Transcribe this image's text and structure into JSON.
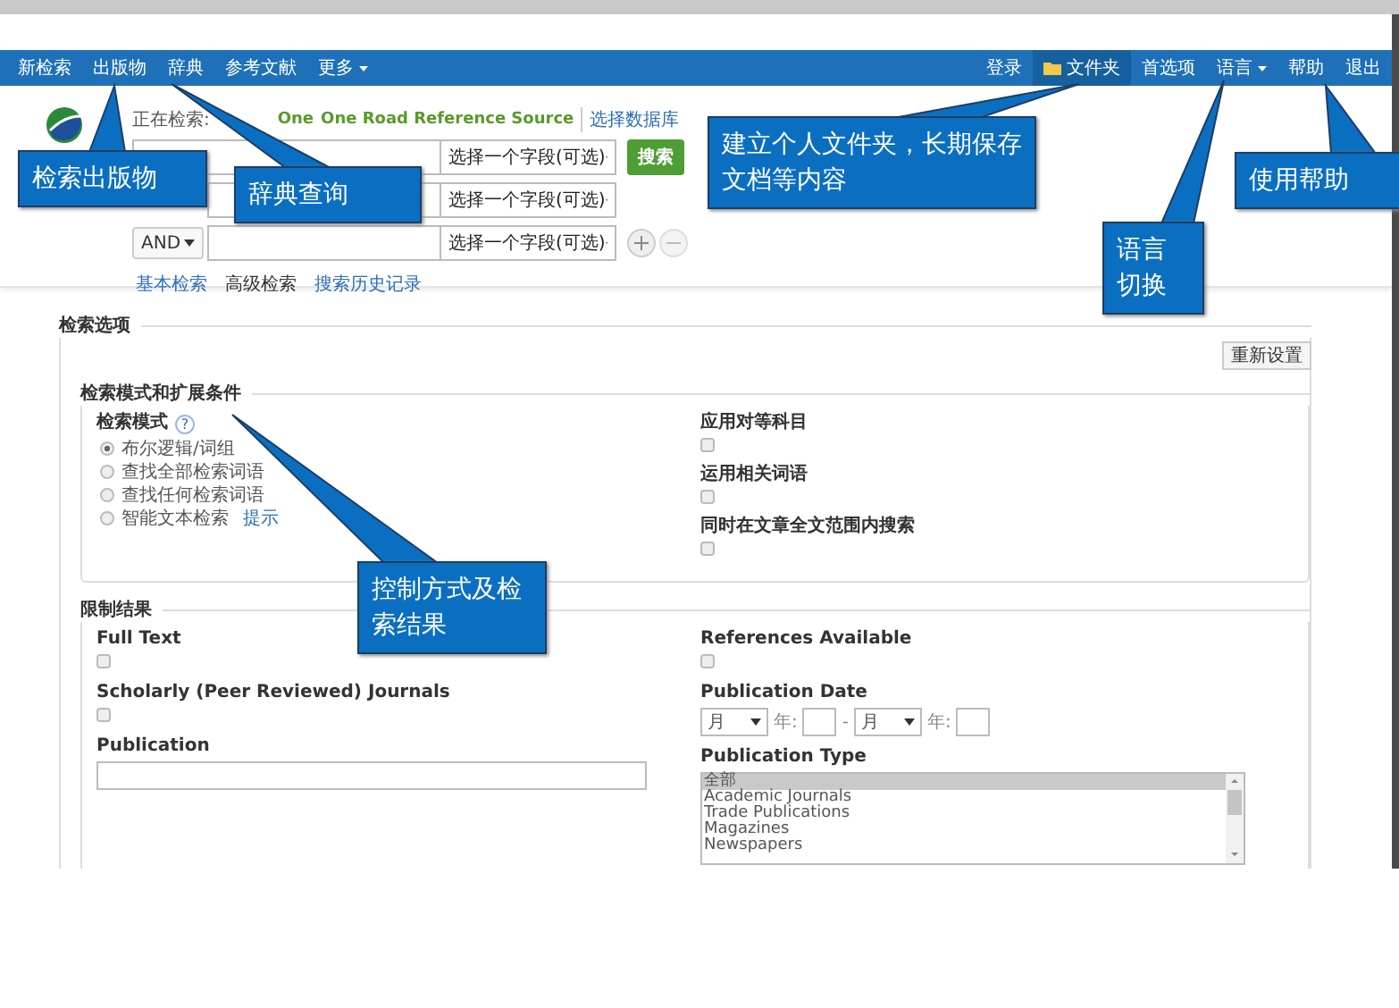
{
  "nav": {
    "left": [
      {
        "label": "新检索",
        "kind": "link"
      },
      {
        "label": "出版物",
        "kind": "link"
      },
      {
        "label": "辞典",
        "kind": "link"
      },
      {
        "label": "参考文献",
        "kind": "link"
      },
      {
        "label": "更多",
        "kind": "menu"
      }
    ],
    "right": [
      {
        "label": "登录",
        "kind": "link"
      },
      {
        "label": "文件夹",
        "kind": "folder"
      },
      {
        "label": "首选项",
        "kind": "link"
      },
      {
        "label": "语言",
        "kind": "menu"
      },
      {
        "label": "帮助",
        "kind": "link"
      },
      {
        "label": "退出",
        "kind": "link"
      }
    ]
  },
  "search": {
    "searching_label": "正在检索:",
    "database_parts": [
      "One",
      "One Road Reference Source"
    ],
    "choose_db_link": "选择数据库",
    "rows": [
      {
        "field": "选择一个字段(可选)"
      },
      {
        "field": "选择一个字段(可选)"
      },
      {
        "operator": "AND",
        "field": "选择一个字段(可选)"
      }
    ],
    "search_button": "搜索",
    "links": [
      {
        "label": "基本检索",
        "selected": false
      },
      {
        "label": "高级检索",
        "selected": true
      },
      {
        "label": "搜索历史记录",
        "selected": false
      }
    ]
  },
  "options": {
    "title": "检索选项",
    "reset_button": "重新设置",
    "modes": {
      "title": "检索模式和扩展条件",
      "mode_label": "检索模式",
      "help": "?",
      "radios": [
        {
          "label": "布尔逻辑/词组",
          "selected": true
        },
        {
          "label": "查找全部检索词语",
          "selected": false
        },
        {
          "label": "查找任何检索词语",
          "selected": false
        },
        {
          "label": "智能文本检索",
          "selected": false
        }
      ],
      "hint_link": "提示",
      "checks": [
        {
          "label": "应用对等科目",
          "checked": false
        },
        {
          "label": "运用相关词语",
          "checked": false
        },
        {
          "label": "同时在文章全文范围内搜索",
          "checked": false
        }
      ]
    },
    "limits": {
      "title": "限制结果",
      "left": [
        {
          "kind": "checkbox",
          "label": "Full Text",
          "checked": false
        },
        {
          "kind": "checkbox",
          "label": "Scholarly (Peer Reviewed) Journals",
          "checked": false
        },
        {
          "kind": "text",
          "label": "Publication"
        }
      ],
      "right": [
        {
          "kind": "checkbox",
          "label": "References Available",
          "checked": false
        },
        {
          "kind": "date",
          "label": "Publication Date",
          "from_month": "月",
          "from_year_label": "年:",
          "separator": "-",
          "to_month": "月",
          "to_year_label": "年:"
        },
        {
          "kind": "listbox",
          "label": "Publication Type",
          "options": [
            {
              "label": "全部",
              "selected": true
            },
            {
              "label": "Academic Journals",
              "selected": false
            },
            {
              "label": "Trade Publications",
              "selected": false
            },
            {
              "label": "Magazines",
              "selected": false
            },
            {
              "label": "Newspapers",
              "selected": false
            }
          ]
        }
      ]
    }
  },
  "annotations": [
    {
      "text": "检索出版物"
    },
    {
      "text": "辞典查询"
    },
    {
      "text": "建立个人文件夹，长期保存文档等内容"
    },
    {
      "text": "语言切换"
    },
    {
      "text": "使用帮助"
    },
    {
      "text": "控制方式及检索结果"
    }
  ]
}
